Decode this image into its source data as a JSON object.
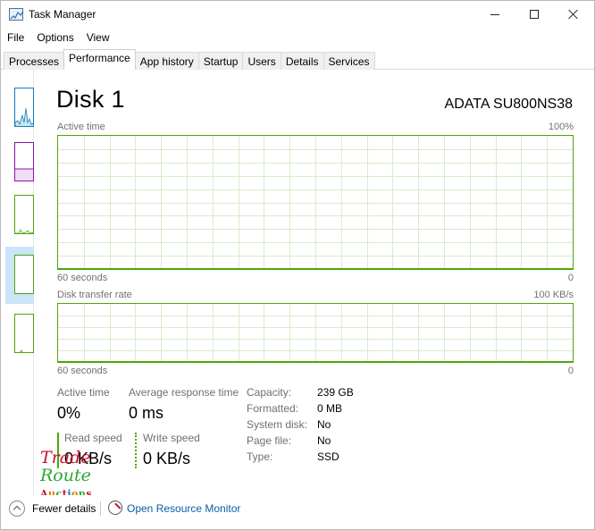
{
  "window": {
    "title": "Task Manager",
    "icon": "task-manager-icon"
  },
  "menu": {
    "items": [
      "File",
      "Options",
      "View"
    ]
  },
  "tabs": [
    {
      "label": "Processes"
    },
    {
      "label": "Performance",
      "active": true
    },
    {
      "label": "App history"
    },
    {
      "label": "Startup"
    },
    {
      "label": "Users"
    },
    {
      "label": "Details"
    },
    {
      "label": "Services"
    }
  ],
  "sidebar": {
    "thumbnails": [
      {
        "name": "cpu",
        "color": "#117dbb"
      },
      {
        "name": "memory",
        "color": "#8b12ae"
      },
      {
        "name": "disk-0",
        "color": "#4da60c"
      },
      {
        "name": "disk-1",
        "color": "#4da60c",
        "selected": true
      },
      {
        "name": "ethernet",
        "color": "#4da60c"
      }
    ]
  },
  "main": {
    "title": "Disk 1",
    "model": "ADATA SU800NS38",
    "graph1": {
      "label": "Active time",
      "max": "100%",
      "time_label": "60 seconds",
      "min": "0",
      "color": "#4da60c"
    },
    "graph2": {
      "label": "Disk transfer rate",
      "max": "100 KB/s",
      "time_label": "60 seconds",
      "min": "0",
      "color": "#4da60c"
    },
    "stats": {
      "active_time_label": "Active time",
      "active_time_value": "0%",
      "avg_response_label": "Average response time",
      "avg_response_value": "0 ms",
      "read_speed_label": "Read speed",
      "read_speed_value": "0 KB/s",
      "write_speed_label": "Write speed",
      "write_speed_value": "0 KB/s"
    },
    "properties": [
      {
        "key": "Capacity:",
        "value": "239 GB"
      },
      {
        "key": "Formatted:",
        "value": "0 MB"
      },
      {
        "key": "System disk:",
        "value": "No"
      },
      {
        "key": "Page file:",
        "value": "No"
      },
      {
        "key": "Type:",
        "value": "SSD"
      }
    ]
  },
  "watermark": {
    "line1": "Trade",
    "line2": "Route",
    "line3": "Auctions"
  },
  "footer": {
    "fewer_details": "Fewer details",
    "open_resource_monitor": "Open Resource Monitor"
  }
}
